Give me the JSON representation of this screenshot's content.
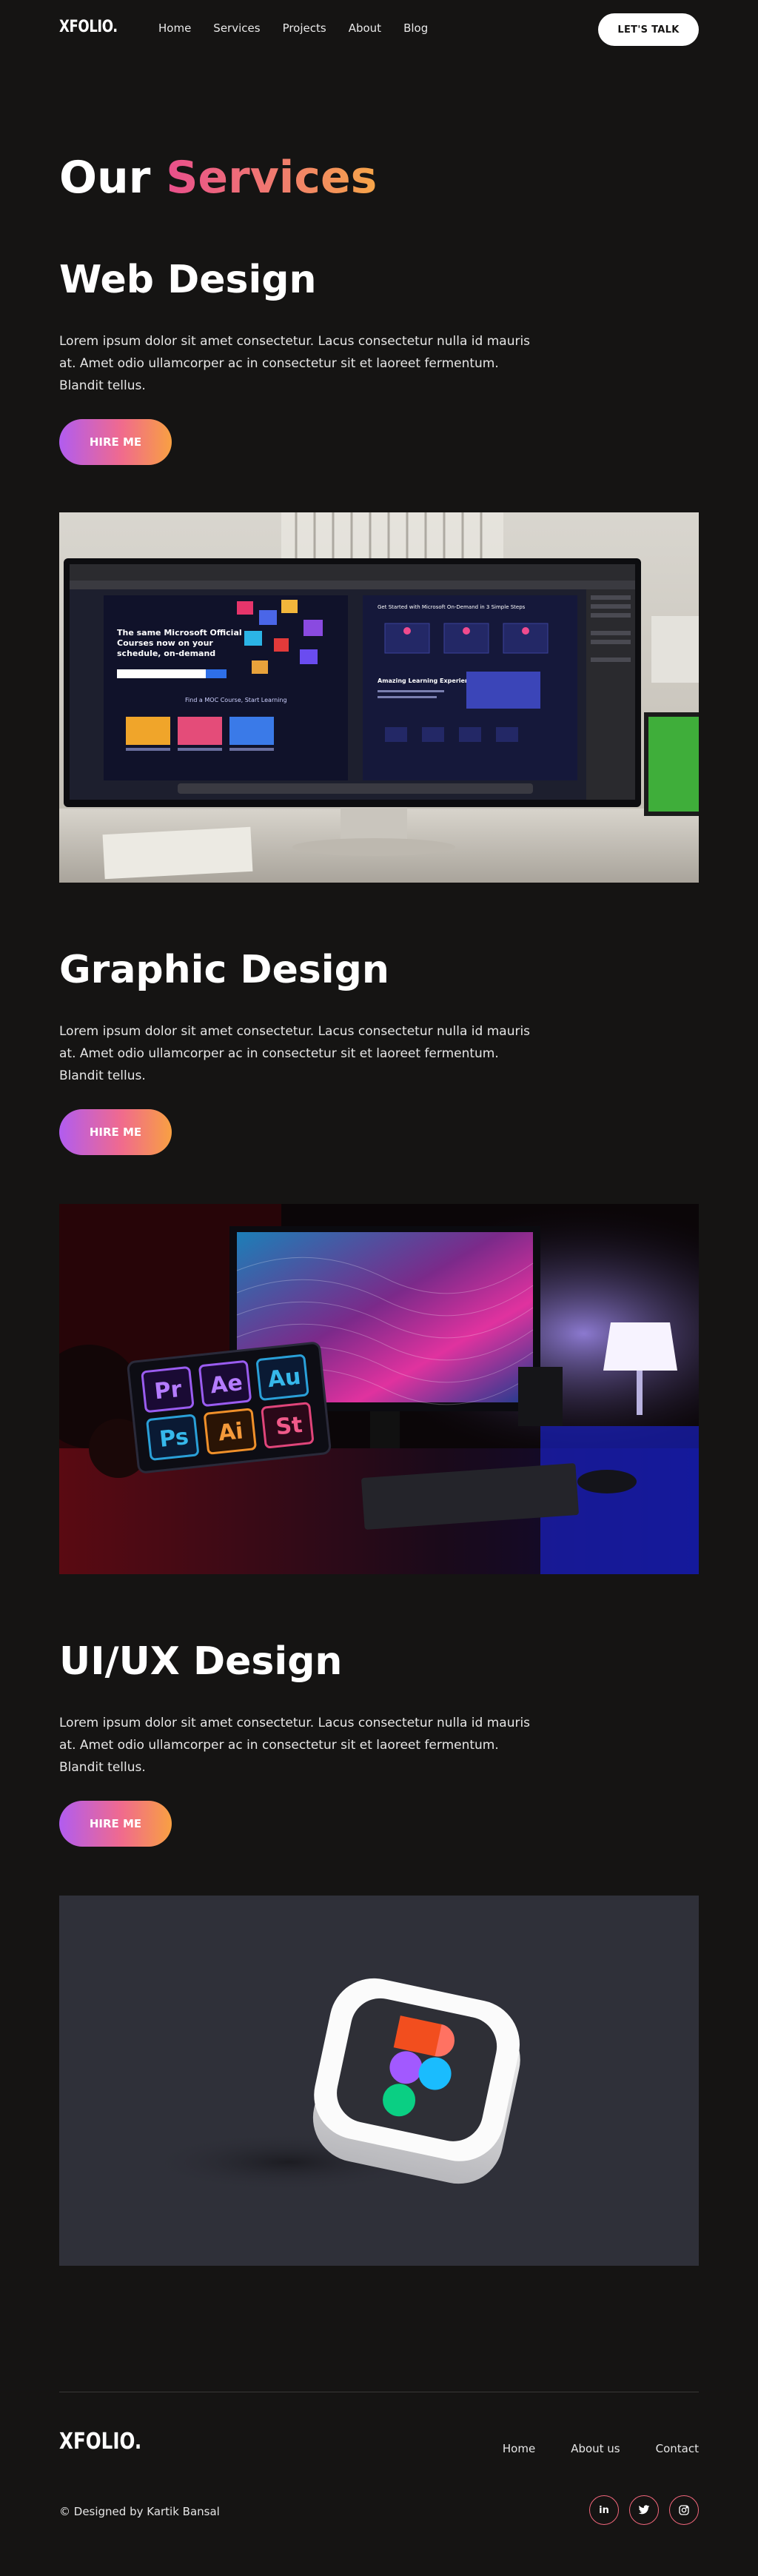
{
  "brand": {
    "logo": "XFOLIO."
  },
  "nav": {
    "links": [
      "Home",
      "Services",
      "Projects",
      "About",
      "Blog"
    ],
    "cta": "LET'S TALK"
  },
  "hero": {
    "title_prefix": "Our",
    "title_accent": "Services"
  },
  "services": [
    {
      "title": "Web Design",
      "description": "Lorem ipsum dolor sit amet consectetur. Lacus consectetur nulla id mauris at. Amet odio ullamcorper ac in consectetur sit et laoreet fermentum. Blandit tellus.",
      "button": "HIRE ME",
      "image_text": {
        "headline": "The same Microsoft Official Courses now on your schedule, on-demand",
        "right_heading": "Get Started with Microsoft On-Demand in 3 Simple Steps",
        "right_sub": "Amazing Learning Experience",
        "left_sub": "Find a MOC Course, Start Learning"
      }
    },
    {
      "title": "Graphic Design",
      "description": "Lorem ipsum dolor sit amet consectetur. Lacus consectetur nulla id mauris at. Amet odio ullamcorper ac in consectetur sit et laoreet fermentum. Blandit tellus.",
      "button": "HIRE ME",
      "image_text": {
        "apps": [
          "Pr",
          "Ae",
          "Au",
          "Ps",
          "Ai",
          "St"
        ]
      }
    },
    {
      "title": "UI/UX Design",
      "description": "Lorem ipsum dolor sit amet consectetur. Lacus consectetur nulla id mauris at. Amet odio ullamcorper ac in consectetur sit et laoreet fermentum. Blandit tellus.",
      "button": "HIRE ME"
    }
  ],
  "footer": {
    "logo": "XFOLIO.",
    "links": [
      "Home",
      "About us",
      "Contact"
    ],
    "copyright": "© Designed by Kartik Bansal",
    "socials": [
      {
        "icon": "linkedin-icon",
        "glyph": "in"
      },
      {
        "icon": "twitter-icon",
        "glyph": "🐦"
      },
      {
        "icon": "instagram-icon",
        "glyph": "◎"
      }
    ]
  },
  "colors": {
    "background": "#151413",
    "accent_pink": "#e94f8c",
    "accent_orange": "#f6a548",
    "accent_purple": "#b15cf0"
  }
}
